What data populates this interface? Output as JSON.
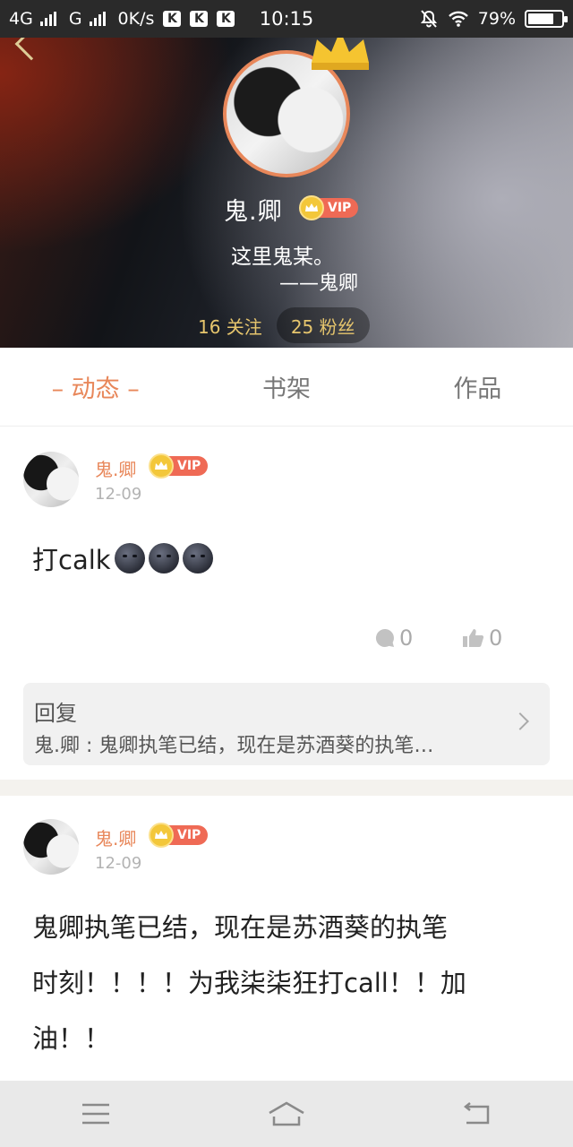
{
  "status_bar": {
    "network1": "4G",
    "network2": "G",
    "speed": "0K/s",
    "k_badges": [
      "K",
      "K",
      "K"
    ],
    "time": "10:15",
    "battery": "79%",
    "battery_level": 0.79
  },
  "profile": {
    "name": "鬼.卿",
    "vip_label": "VIP",
    "bio_line1": "这里鬼某。",
    "bio_line2": "——鬼卿",
    "following": "16 关注",
    "fans": "25 粉丝"
  },
  "tabs": [
    {
      "label": "– 动态 –",
      "active": true
    },
    {
      "label": "书架",
      "active": false
    },
    {
      "label": "作品",
      "active": false
    }
  ],
  "posts": [
    {
      "author": "鬼.卿",
      "vip_label": "VIP",
      "date": "12-09",
      "text": "打calk",
      "emoji_count": 3,
      "emoji_icon": "new-moon-face-icon",
      "comments": "0",
      "likes": "0",
      "reply": {
        "title": "回复",
        "text": "鬼.卿 : 鬼卿执笔已结，现在是苏酒葵的执笔…"
      }
    },
    {
      "author": "鬼.卿",
      "vip_label": "VIP",
      "date": "12-09",
      "text_line1": "鬼卿执笔已结，现在是苏酒葵的执笔",
      "text_line2": "时刻！！！！为我柒柒狂打call！！加",
      "text_line3": "油！！"
    }
  ],
  "nav": {
    "menu_icon": "menu-icon",
    "home_icon": "home-icon",
    "back_icon": "back-icon"
  },
  "colors": {
    "accent": "#e8875a",
    "gold": "#e6c56d",
    "vip_red": "#ef6a55"
  }
}
